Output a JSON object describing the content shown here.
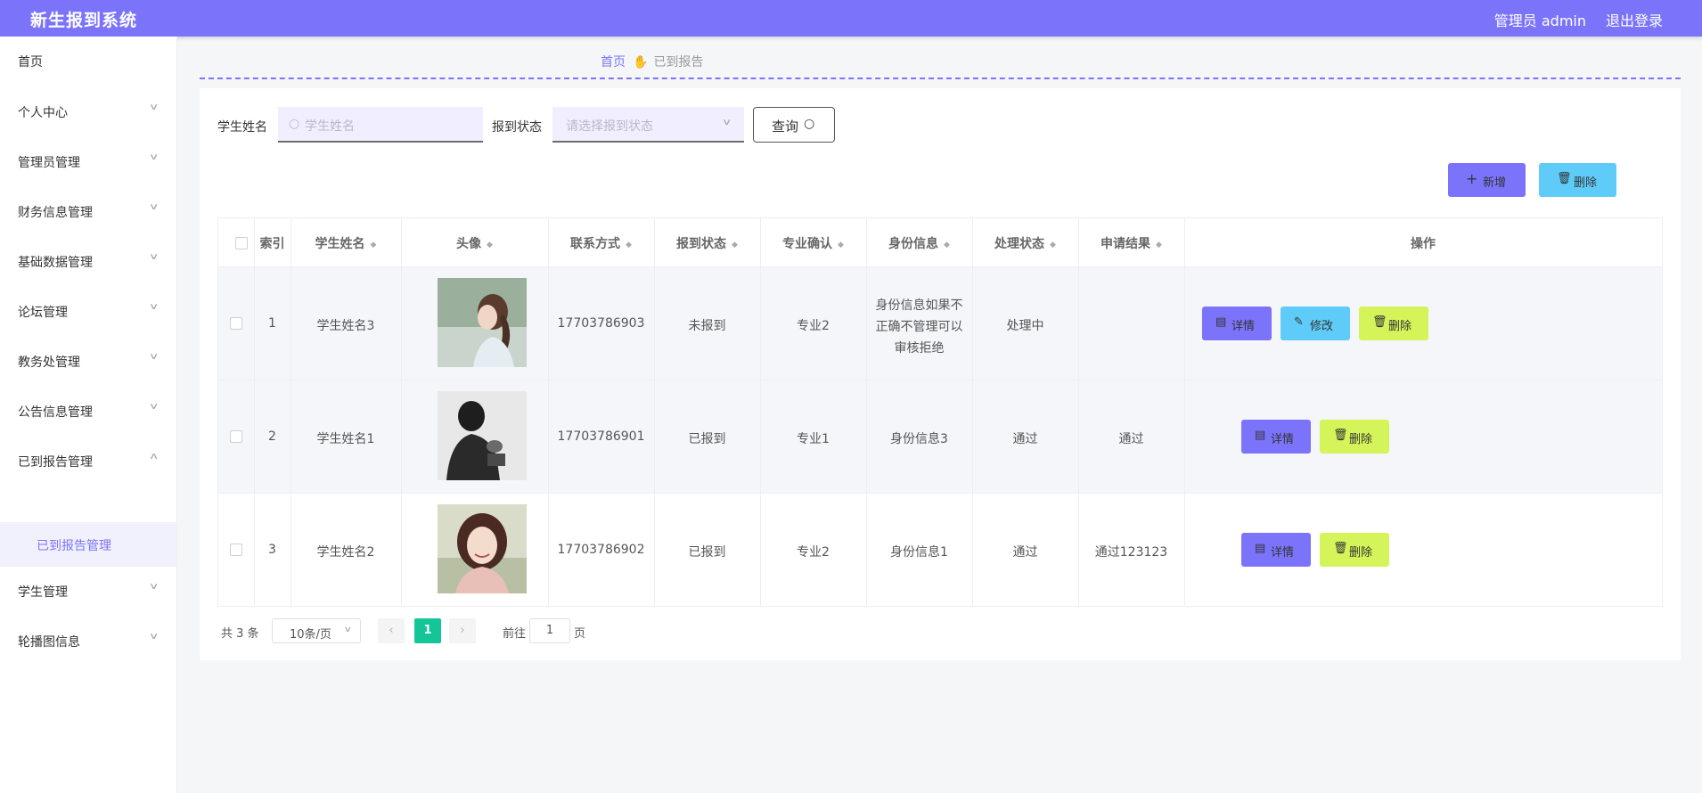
{
  "app": {
    "title": "新生报到系统",
    "user": "管理员 admin",
    "logout": "退出登录"
  },
  "sidebar": {
    "items": [
      {
        "label": "首页"
      },
      {
        "label": "个人中心"
      },
      {
        "label": "管理员管理"
      },
      {
        "label": "财务信息管理"
      },
      {
        "label": "基础数据管理"
      },
      {
        "label": "论坛管理"
      },
      {
        "label": "教务处管理"
      },
      {
        "label": "公告信息管理"
      },
      {
        "label": "已到报告管理"
      },
      {
        "label": "学生管理"
      },
      {
        "label": "轮播图信息"
      }
    ],
    "active_sub": "已到报告管理"
  },
  "breadcrumb": {
    "home": "首页",
    "current": "已到报告"
  },
  "search": {
    "name_label": "学生姓名",
    "name_placeholder": "学生姓名",
    "status_label": "报到状态",
    "status_placeholder": "请选择报到状态",
    "query_label": "查询"
  },
  "toolbar": {
    "add_label": "新增",
    "delete_label": "删除"
  },
  "table": {
    "headers": [
      "索引",
      "学生姓名",
      "头像",
      "联系方式",
      "报到状态",
      "专业确认",
      "身份信息",
      "处理状态",
      "申请结果",
      "操作"
    ],
    "rows": [
      {
        "index": "1",
        "name": "学生姓名3",
        "phone": "17703786903",
        "status": "未报到",
        "major": "专业2",
        "identity": "身份信息如果不正确不管理可以审核拒绝",
        "process": "处理中",
        "result": ""
      },
      {
        "index": "2",
        "name": "学生姓名1",
        "phone": "17703786901",
        "status": "已报到",
        "major": "专业1",
        "identity": "身份信息3",
        "process": "通过",
        "result": "通过"
      },
      {
        "index": "3",
        "name": "学生姓名2",
        "phone": "17703786902",
        "status": "已报到",
        "major": "专业2",
        "identity": "身份信息1",
        "process": "通过",
        "result": "通过123123"
      }
    ],
    "actions": {
      "detail": "详情",
      "edit": "修改",
      "delete": "删除"
    }
  },
  "pagination": {
    "total": "共 3 条",
    "page_size": "10条/页",
    "current": "1",
    "goto": "前往",
    "goto_value": "1",
    "page_unit": "页"
  },
  "colors": {
    "primary": "#7b74fb",
    "info": "#5ecbf8",
    "warning": "#d4f45a",
    "success": "#13c597"
  }
}
